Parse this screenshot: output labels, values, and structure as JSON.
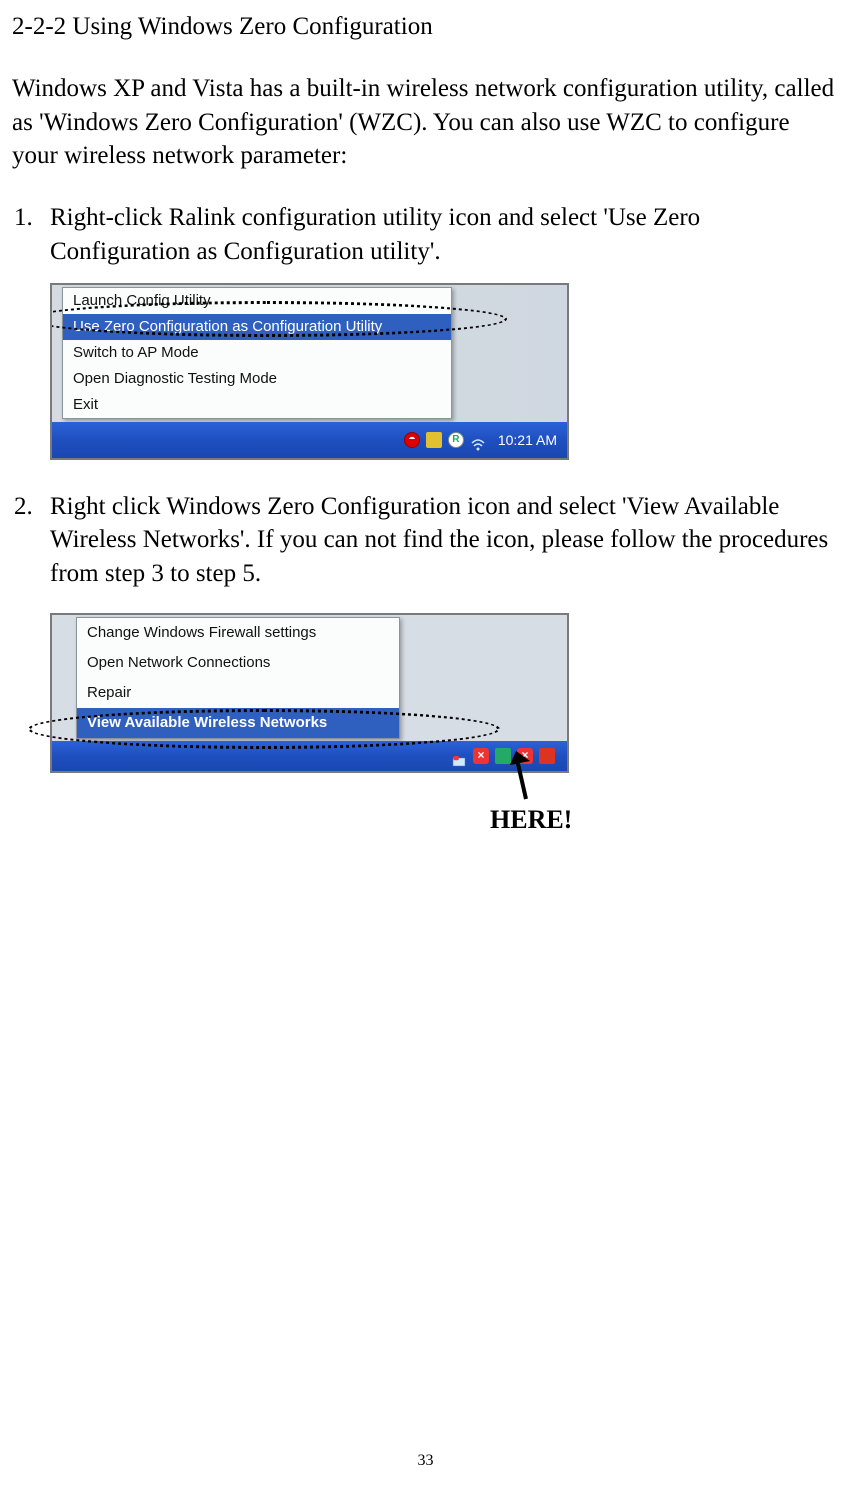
{
  "heading": "2-2-2 Using Windows Zero Configuration",
  "intro": "Windows XP and Vista has a built-in wireless network configuration utility, called as 'Windows Zero Configuration' (WZC). You can also use WZC to configure your wireless network parameter:",
  "step1": {
    "number": "1.",
    "text": "Right-click Ralink configuration utility icon and select 'Use Zero Configuration as Configuration utility'."
  },
  "step2": {
    "number": "2.",
    "text": "Right click Windows Zero Configuration icon and select 'View Available Wireless Networks'. If you can not find the icon, please follow the procedures from step 3 to step 5."
  },
  "shot1": {
    "menu": {
      "items": [
        "Launch Config Utility",
        "Use Zero Configuration as Configuration Utility",
        "Switch to AP Mode",
        "Open Diagnostic Testing Mode",
        "Exit"
      ],
      "selectedIndex": 1
    },
    "clock": "10:21 AM"
  },
  "shot2": {
    "menu": {
      "items": [
        "Change Windows Firewall settings",
        "Open Network Connections",
        "Repair",
        "View Available Wireless Networks"
      ],
      "selectedIndex": 3
    }
  },
  "annotation": "HERE!",
  "pageNumber": "33"
}
